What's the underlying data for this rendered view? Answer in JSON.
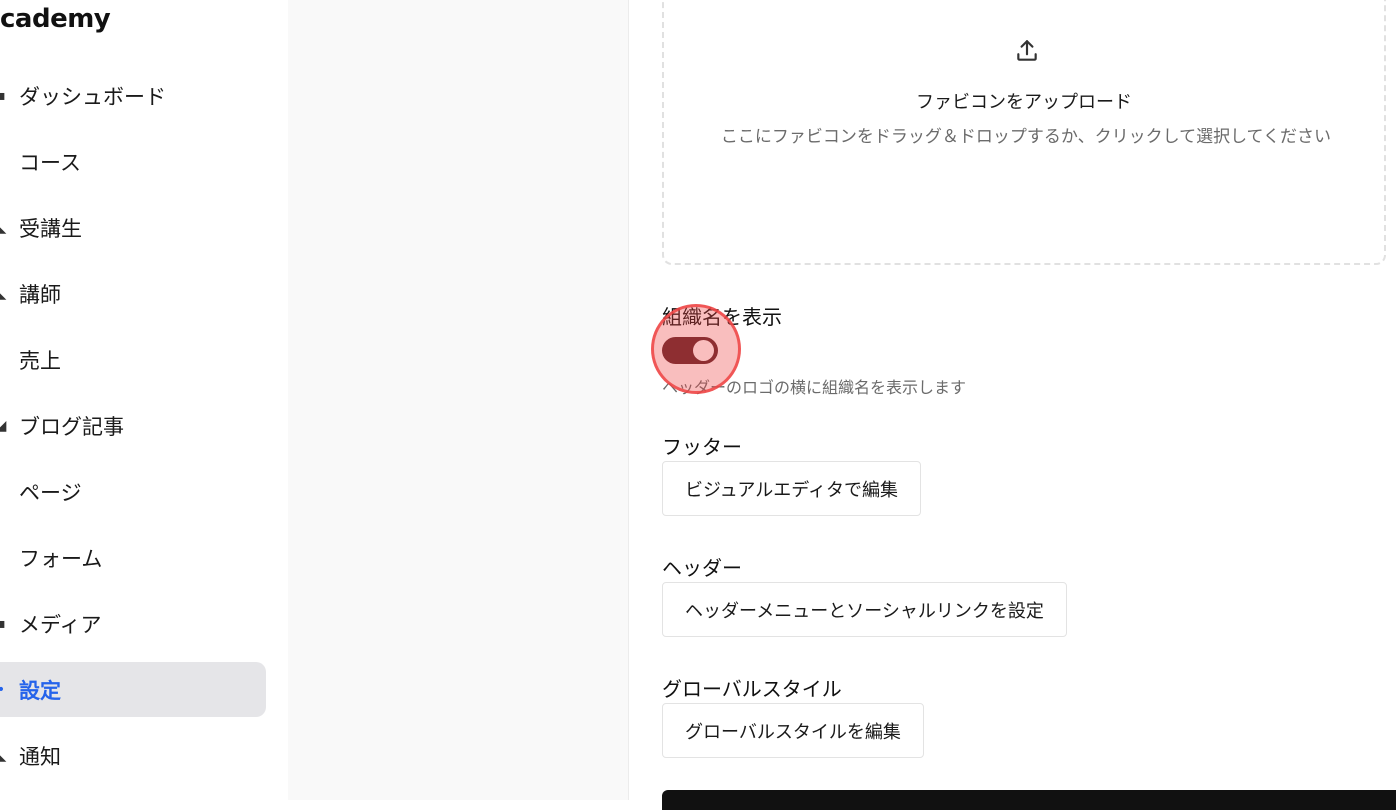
{
  "sidebar": {
    "brand": "cademy",
    "items": [
      {
        "label": "ダッシュボード",
        "icon": "dashboard-icon",
        "glyph": "▪",
        "active": false
      },
      {
        "label": "コース",
        "icon": "course-icon",
        "glyph": "",
        "active": false
      },
      {
        "label": "受講生",
        "icon": "students-icon",
        "glyph": "◣",
        "active": false
      },
      {
        "label": "講師",
        "icon": "instructor-icon",
        "glyph": "◣",
        "active": false
      },
      {
        "label": "売上",
        "icon": "sales-icon",
        "glyph": "",
        "active": false
      },
      {
        "label": "ブログ記事",
        "icon": "blog-icon",
        "glyph": "◢",
        "active": false
      },
      {
        "label": "ページ",
        "icon": "page-icon",
        "glyph": "",
        "active": false
      },
      {
        "label": "フォーム",
        "icon": "form-icon",
        "glyph": "",
        "active": false
      },
      {
        "label": "メディア",
        "icon": "media-icon",
        "glyph": "▪",
        "active": false
      },
      {
        "label": "設定",
        "icon": "settings-icon",
        "glyph": "•",
        "active": true
      },
      {
        "label": "通知",
        "icon": "notification-icon",
        "glyph": "◣",
        "active": false
      }
    ]
  },
  "favicon_upload": {
    "title": "ファビコンをアップロード",
    "subtitle": "ここにファビコンをドラッグ＆ドロップするか、クリックして選択してください"
  },
  "show_org_name": {
    "label": "組織名を表示",
    "enabled": true,
    "help": "ヘッダーのロゴの横に組織名を表示します"
  },
  "footer": {
    "label": "フッター",
    "button": "ビジュアルエディタで編集"
  },
  "header": {
    "label": "ヘッダー",
    "button": "ヘッダーメニューとソーシャルリンクを設定"
  },
  "global_style": {
    "label": "グローバルスタイル",
    "button": "グローバルスタイルを編集"
  },
  "colors": {
    "accent": "#2563eb",
    "toggle_on": "#5b2227",
    "active_nav_bg": "#e5e5e8"
  }
}
